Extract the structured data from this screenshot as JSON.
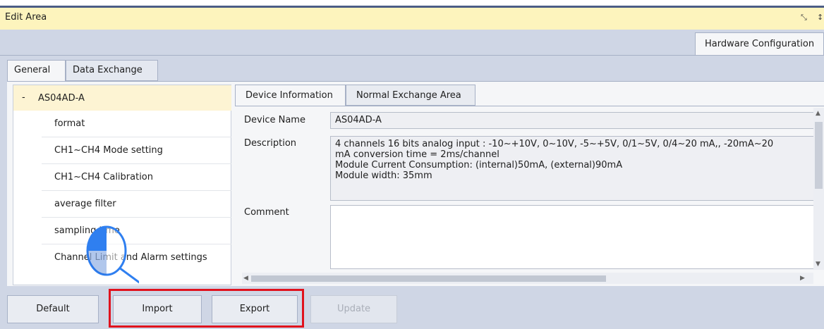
{
  "header": {
    "title": "Edit Area",
    "icons": [
      "restore-icon",
      "pin-icon"
    ]
  },
  "top_tabs": [
    {
      "label": "Hardware Configuration",
      "active": true
    }
  ],
  "sub_tabs": [
    {
      "label": "General",
      "active": true
    },
    {
      "label": "Data Exchange",
      "active": false
    }
  ],
  "tree": {
    "collapse_symbol": "-",
    "root": "AS04AD-A",
    "items": [
      "format",
      "CH1~CH4 Mode setting",
      "CH1~CH4 Calibration",
      "average filter",
      "sampling time",
      "Channel Limit and Alarm settings"
    ]
  },
  "right_tabs": [
    {
      "label": "Device Information",
      "active": true
    },
    {
      "label": "Normal Exchange Area",
      "active": false
    }
  ],
  "device": {
    "name_label": "Device Name",
    "name": "AS04AD-A",
    "description_label": "Description",
    "description_lines": [
      "4 channels 16 bits analog input : -10~+10V, 0~10V, -5~+5V, 0/1~5V, 0/4~20 mA,, -20mA~20",
      "mA conversion time = 2ms/channel",
      "Module Current Consumption: (internal)50mA, (external)90mA",
      "Module width: 35mm"
    ],
    "comment_label": "Comment",
    "comment": ""
  },
  "buttons": {
    "default": "Default",
    "import": "Import",
    "export": "Export",
    "update": "Update"
  },
  "colors": {
    "highlight": "#e0121d",
    "header_bg": "#fdf4bd",
    "cursor": "#2f7ff0"
  }
}
